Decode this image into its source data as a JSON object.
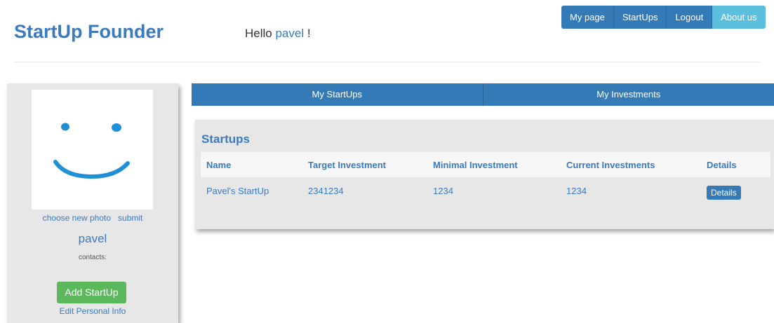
{
  "header": {
    "brand": "StartUp Founder",
    "greeting_prefix": "Hello ",
    "greeting_user": "pavel",
    "greeting_suffix": " !"
  },
  "topnav": [
    "My page",
    "StartUps",
    "Logout",
    "About us"
  ],
  "sidebar": {
    "photo_icon": "smiley-face",
    "choose_photo": "choose new photo",
    "submit": "submit",
    "username": "pavel",
    "contacts": "contacts:",
    "add_startup": "Add StartUp",
    "edit_info": "Edit Personal Info"
  },
  "tabs": [
    "My StartUps",
    "My Investments"
  ],
  "startups": {
    "title": "Startups",
    "columns": [
      "Name",
      "Target Investment",
      "Minimal Investment",
      "Current Investments",
      "Details"
    ],
    "rows": [
      {
        "name": "Pavel's StartUp",
        "target": "2341234",
        "minimal": "1234",
        "current": "1234",
        "details": "Details"
      }
    ]
  },
  "colors": {
    "primary": "#337ab7",
    "info": "#5bc0de",
    "success": "#5cb85c",
    "panel": "#e7e7e7"
  }
}
